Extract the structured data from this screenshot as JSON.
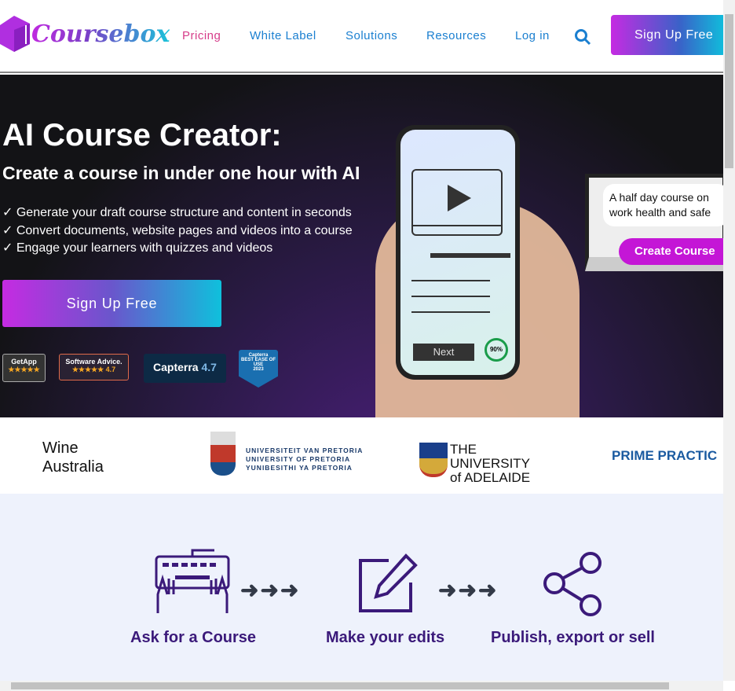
{
  "header": {
    "logo": "Coursebox",
    "nav": [
      "Pricing",
      "White Label",
      "Solutions",
      "Resources",
      "Log in"
    ],
    "signup": "Sign Up Free"
  },
  "hero": {
    "title": "AI Course Creator:",
    "subtitle": "Create a course in under one hour with AI",
    "bullets": [
      "✓ Generate your draft course structure and content in seconds",
      "✓ Convert documents, website pages and videos into a course",
      "✓ Engage your learners with quizzes and videos"
    ],
    "cta": "Sign Up Free",
    "badges": [
      {
        "name": "GetApp",
        "rating": "★★★★★"
      },
      {
        "name": "Software Advice.",
        "rating": "★★★★★ 4.7"
      },
      {
        "name": "Capterra",
        "rating": "4.7"
      },
      {
        "name": "Capterra",
        "award": "BEST EASE OF USE",
        "year": "2023"
      }
    ],
    "phone": {
      "next": "Next",
      "progress": "90%"
    },
    "monitor": {
      "prompt": "A half day course on work health and safe",
      "button": "Create Course"
    }
  },
  "logos": [
    "Wine Australia",
    "UNIVERSITEIT VAN PRETORIA\nUNIVERSITY OF PRETORIA\nYUNIBESITHI YA PRETORIA",
    "THE UNIVERSITY of ADELAIDE",
    "PRIME PRACTIC"
  ],
  "steps": [
    "Ask for a Course",
    "Make your edits",
    "Publish, export or sell"
  ],
  "colors": {
    "accent_pink": "#d63d8a",
    "nav_blue": "#1a7fd0",
    "step_purple": "#3b1a7a",
    "steps_bg": "#eef2fc"
  }
}
